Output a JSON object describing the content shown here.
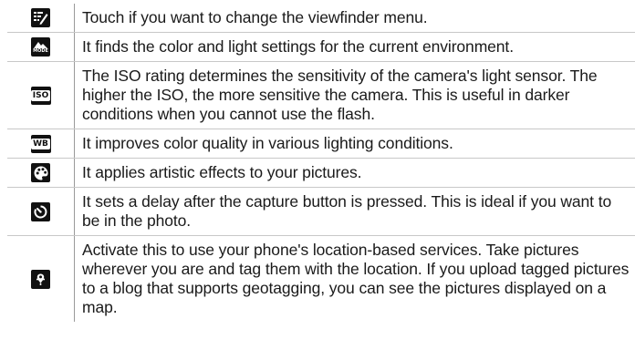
{
  "rows": [
    {
      "icon": "viewfinder-menu-icon",
      "text": "Touch if you want to change the viewfinder menu."
    },
    {
      "icon": "mode-icon",
      "icon_label": "MODE",
      "text": "It finds the color and light settings for the current environment."
    },
    {
      "icon": "iso-icon",
      "icon_label": "ISO",
      "text": "The ISO rating determines the sensitivity of the camera's light sensor. The higher the ISO, the more sensitive the camera. This is useful in darker conditions when you cannot use the flash."
    },
    {
      "icon": "white-balance-icon",
      "icon_label": "WB",
      "text": "It improves color quality in various lighting conditions."
    },
    {
      "icon": "palette-icon",
      "text": "It applies artistic effects to your pictures."
    },
    {
      "icon": "timer-icon",
      "text": "It sets a delay after the capture button is pressed. This is ideal if you want to be in the photo."
    },
    {
      "icon": "geotag-icon",
      "text": "Activate this to use your phone's location-based services. Take pictures wherever you are and tag them with the location. If you upload tagged pictures to a blog that supports geotagging, you can see the pictures displayed on a map."
    }
  ]
}
